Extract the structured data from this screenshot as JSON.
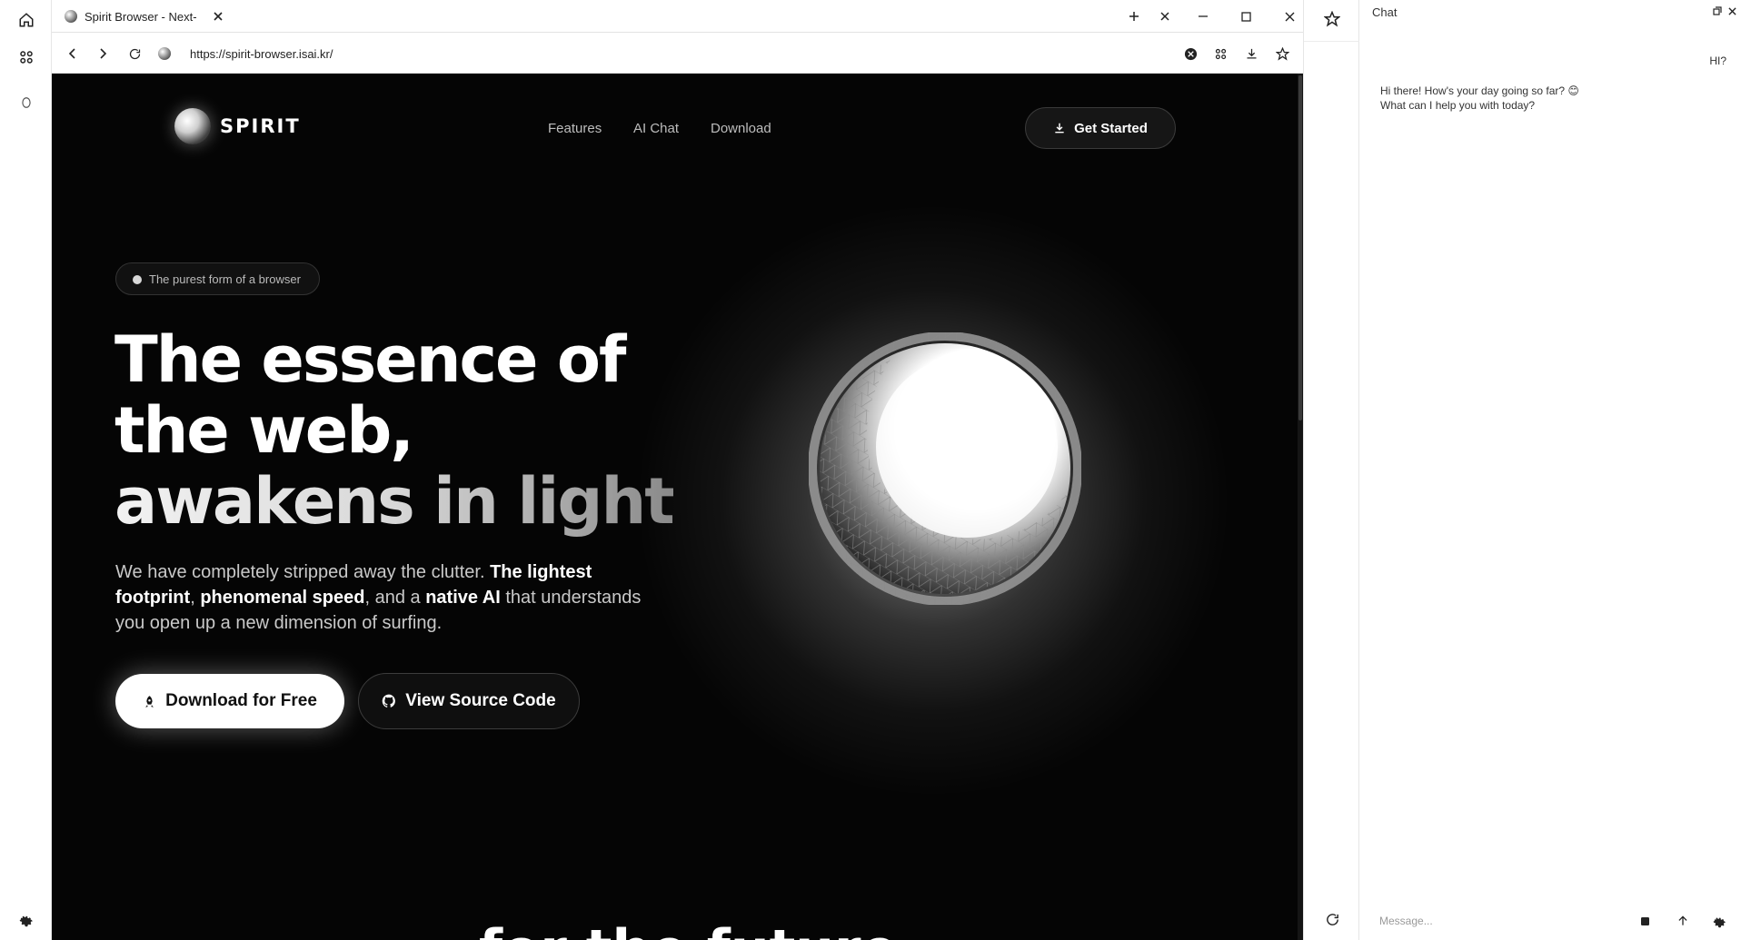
{
  "browser": {
    "tab_title": "Spirit Browser - Next-",
    "url": "https://spirit-browser.isai.kr/"
  },
  "site": {
    "brand": "SPIRIT",
    "nav": [
      "Features",
      "AI Chat",
      "Download"
    ],
    "cta_top": "Get Started",
    "pill": "The purest form of a browser",
    "hero_line1": "The essence of",
    "hero_line2": "the web,",
    "hero_line3": "awakens in light",
    "sub": {
      "p1": "We have completely stripped away the clutter. ",
      "b1": "The lightest footprint",
      "p2": ", ",
      "b2": "phenomenal speed",
      "p3": ", and a ",
      "b3": "native AI",
      "p4": " that understands you open up a new dimension of surfing."
    },
    "btn_download": "Download for Free",
    "btn_source": "View Source Code",
    "next_heading": "for the future."
  },
  "chat": {
    "title": "Chat",
    "user_msg": "HI?",
    "bot_line1": "Hi there! How's your day going so far? 😊",
    "bot_line2": "What can I help you with today?",
    "placeholder": "Message..."
  },
  "colors": {
    "page_bg": "#050505",
    "accent": "#ffffff"
  }
}
